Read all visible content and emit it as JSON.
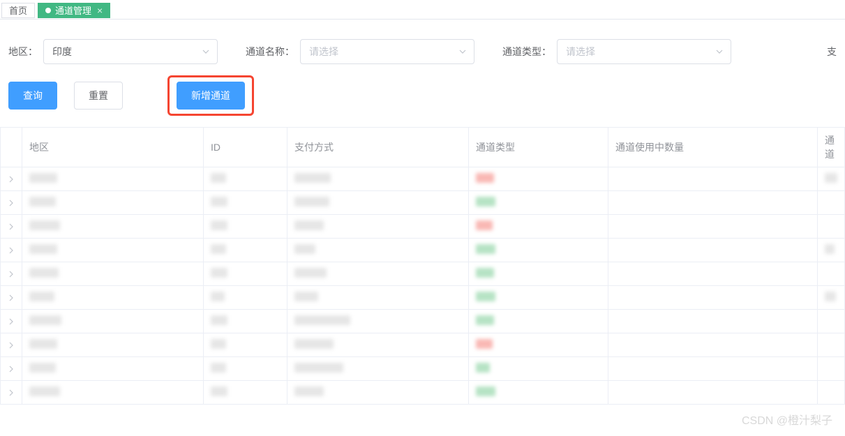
{
  "tabs": {
    "home": "首页",
    "active": "通道管理"
  },
  "filters": {
    "region_label": "地区：",
    "region_value": "印度",
    "channel_name_label": "通道名称：",
    "channel_name_placeholder": "请选择",
    "channel_type_label": "通道类型：",
    "channel_type_placeholder": "请选择",
    "extra_label": "支"
  },
  "buttons": {
    "search": "查询",
    "reset": "重置",
    "add_channel": "新增通道"
  },
  "table": {
    "headers": {
      "region": "地区",
      "id": "ID",
      "pay_method": "支付方式",
      "channel_type": "通道类型",
      "in_use_count": "通道使用中数量",
      "channel": "通道"
    },
    "rows": [
      {
        "region_w": 40,
        "id_w": 22,
        "pay_w": 52,
        "type_color": "red",
        "type_w": 26,
        "count_w": 0,
        "ch_w": 18
      },
      {
        "region_w": 38,
        "id_w": 24,
        "pay_w": 50,
        "type_color": "green",
        "type_w": 28,
        "count_w": 0,
        "ch_w": 0
      },
      {
        "region_w": 44,
        "id_w": 24,
        "pay_w": 42,
        "type_color": "red",
        "type_w": 24,
        "count_w": 0,
        "ch_w": 0
      },
      {
        "region_w": 40,
        "id_w": 22,
        "pay_w": 30,
        "type_color": "green",
        "type_w": 28,
        "count_w": 0,
        "ch_w": 14
      },
      {
        "region_w": 42,
        "id_w": 24,
        "pay_w": 46,
        "type_color": "green",
        "type_w": 26,
        "count_w": 0,
        "ch_w": 0
      },
      {
        "region_w": 36,
        "id_w": 20,
        "pay_w": 34,
        "type_color": "green",
        "type_w": 28,
        "count_w": 0,
        "ch_w": 16
      },
      {
        "region_w": 46,
        "id_w": 24,
        "pay_w": 80,
        "type_color": "green",
        "type_w": 26,
        "count_w": 0,
        "ch_w": 0
      },
      {
        "region_w": 40,
        "id_w": 22,
        "pay_w": 56,
        "type_color": "red",
        "type_w": 24,
        "count_w": 0,
        "ch_w": 0
      },
      {
        "region_w": 38,
        "id_w": 22,
        "pay_w": 70,
        "type_color": "green",
        "type_w": 20,
        "count_w": 0,
        "ch_w": 0
      },
      {
        "region_w": 44,
        "id_w": 24,
        "pay_w": 42,
        "type_color": "green",
        "type_w": 28,
        "count_w": 0,
        "ch_w": 0
      }
    ]
  },
  "watermark": "CSDN @橙汁梨子"
}
